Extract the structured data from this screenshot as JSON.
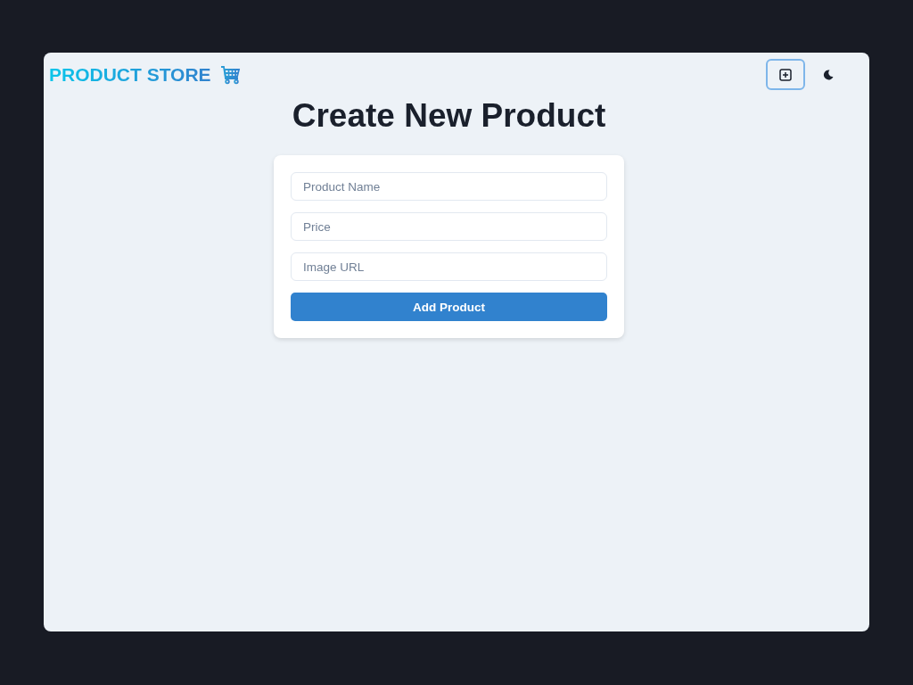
{
  "navbar": {
    "brand": "PRODUCT STORE",
    "buttons": [
      {
        "kind": "create",
        "focused": true
      },
      {
        "kind": "theme",
        "focused": false
      }
    ]
  },
  "heading": "Create New Product",
  "form": {
    "fields": [
      {
        "placeholder": "Product Name"
      },
      {
        "placeholder": "Price"
      },
      {
        "placeholder": "Image URL"
      }
    ],
    "submit": "Add Product"
  }
}
